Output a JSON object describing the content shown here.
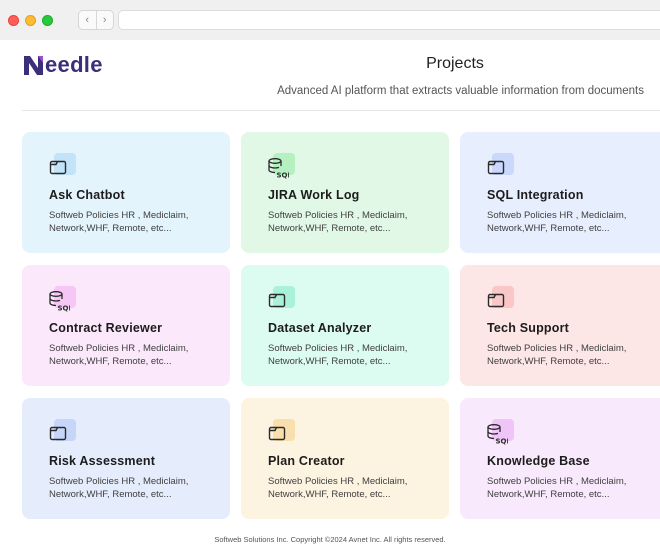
{
  "browser": {
    "back_icon": "chevron-left-icon",
    "forward_icon": "chevron-right-icon"
  },
  "header": {
    "logo_text": "eedle",
    "title": "Projects",
    "subtitle": "Advanced AI platform that extracts valuable information from documents"
  },
  "projects": [
    {
      "title": "Ask Chatbot",
      "desc": "Softweb Policies HR , Mediclaim, Network,WHF, Remote, etc...",
      "icon": "folder-icon",
      "bg": "#e4f4fc",
      "accent": "#c3e3f8"
    },
    {
      "title": "JIRA Work Log",
      "desc": "Softweb Policies HR , Mediclaim, Network,WHF, Remote, etc...",
      "icon": "sql-database-icon",
      "bg": "#e1f8e6",
      "accent": "#b5f0c1"
    },
    {
      "title": "SQL Integration",
      "desc": "Softweb Policies HR , Mediclaim, Network,WHF, Remote, etc...",
      "icon": "folder-icon",
      "bg": "#e7eefd",
      "accent": "#c9d8fb"
    },
    {
      "title": "Contract Reviewer",
      "desc": "Softweb Policies HR , Mediclaim, Network,WHF, Remote, etc...",
      "icon": "sql-database-icon",
      "bg": "#fbe8fb",
      "accent": "#f6c6f4"
    },
    {
      "title": "Dataset Analyzer",
      "desc": "Softweb Policies HR , Mediclaim, Network,WHF, Remote, etc...",
      "icon": "folder-icon",
      "bg": "#dcfbf1",
      "accent": "#a9f2d9"
    },
    {
      "title": "Tech Support",
      "desc": "Softweb Policies HR , Mediclaim, Network,WHF, Remote, etc...",
      "icon": "folder-icon",
      "bg": "#fde6e6",
      "accent": "#f9c7c7"
    },
    {
      "title": "Risk Assessment",
      "desc": "Softweb Policies HR , Mediclaim, Network,WHF, Remote, etc...",
      "icon": "folder-icon",
      "bg": "#e5ecfc",
      "accent": "#c7d6f8"
    },
    {
      "title": "Plan Creator",
      "desc": "Softweb Policies HR , Mediclaim, Network,WHF, Remote, etc...",
      "icon": "folder-icon",
      "bg": "#fdf3e1",
      "accent": "#f9dfae"
    },
    {
      "title": "Knowledge Base",
      "desc": "Softweb Policies HR , Mediclaim, Network,WHF, Remote, etc...",
      "icon": "sql-database-icon",
      "bg": "#f8e9fc",
      "accent": "#efc5f8"
    }
  ],
  "footer": "Softweb Solutions Inc. Copyright ©2024 Avnet Inc. All rights reserved."
}
